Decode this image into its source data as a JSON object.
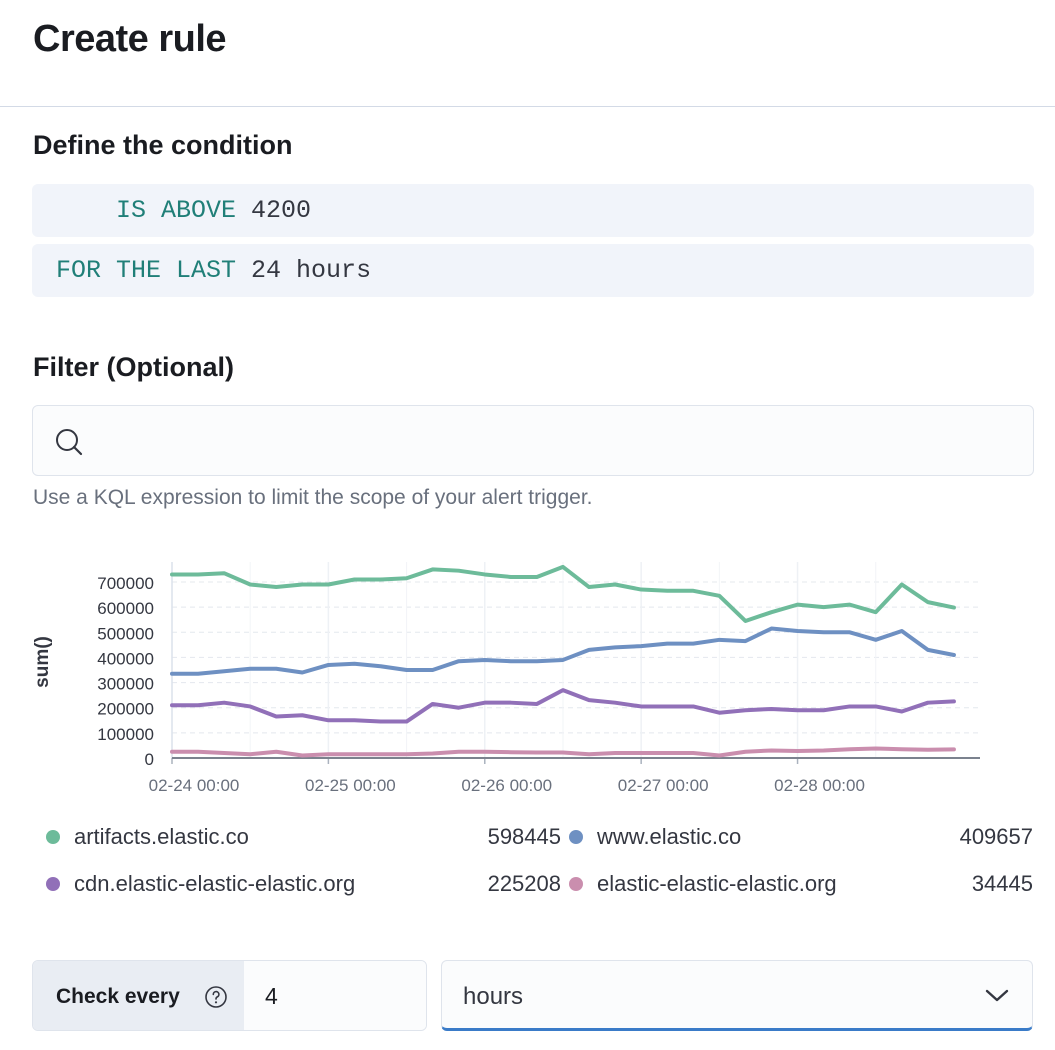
{
  "header": {
    "title": "Create rule"
  },
  "condition": {
    "section_title": "Define the condition",
    "threshold_keyword": "IS ABOVE",
    "threshold_value": "4200",
    "window_keyword": "FOR THE LAST",
    "window_value": "24 hours"
  },
  "filter": {
    "section_title": "Filter (Optional)",
    "query_value": "",
    "placeholder": "",
    "icon": "search-icon",
    "help_text": "Use a KQL expression to limit the scope of your alert trigger."
  },
  "chart_data": {
    "type": "line",
    "title": "",
    "xlabel": "",
    "ylabel": "sum()",
    "ylim": [
      0,
      700000
    ],
    "yticks": [
      "700000",
      "600000",
      "500000",
      "400000",
      "300000",
      "200000",
      "100000",
      "0"
    ],
    "xticks": [
      "02-24 00:00",
      "02-25 00:00",
      "02-26 00:00",
      "02-27 00:00",
      "02-28 00:00"
    ],
    "grid": true,
    "x_points": 32,
    "series": [
      {
        "name": "artifacts.elastic.co",
        "color": "#6dbb9a",
        "values": [
          730000,
          730000,
          735000,
          690000,
          680000,
          690000,
          690000,
          710000,
          710000,
          715000,
          750000,
          745000,
          730000,
          720000,
          720000,
          760000,
          680000,
          690000,
          670000,
          665000,
          665000,
          645000,
          545000,
          580000,
          610000,
          600000,
          610000,
          580000,
          690000,
          620000,
          598445
        ]
      },
      {
        "name": "www.elastic.co",
        "color": "#6e90c2",
        "values": [
          335000,
          335000,
          345000,
          355000,
          355000,
          340000,
          370000,
          375000,
          365000,
          350000,
          350000,
          385000,
          390000,
          385000,
          385000,
          390000,
          430000,
          440000,
          445000,
          455000,
          455000,
          470000,
          465000,
          515000,
          505000,
          500000,
          500000,
          470000,
          505000,
          430000,
          409657
        ]
      },
      {
        "name": "cdn.elastic-elastic-elastic.org",
        "color": "#9170b8",
        "values": [
          210000,
          210000,
          220000,
          205000,
          165000,
          170000,
          150000,
          150000,
          145000,
          145000,
          215000,
          200000,
          220000,
          220000,
          215000,
          270000,
          230000,
          220000,
          205000,
          205000,
          205000,
          180000,
          190000,
          195000,
          190000,
          190000,
          205000,
          205000,
          185000,
          220000,
          225208
        ]
      },
      {
        "name": "elastic-elastic-elastic.org",
        "color": "#ca8eae",
        "values": [
          25000,
          25000,
          20000,
          15000,
          25000,
          10000,
          15000,
          15000,
          15000,
          15000,
          18000,
          25000,
          25000,
          23000,
          22000,
          22000,
          15000,
          20000,
          20000,
          20000,
          20000,
          10000,
          25000,
          30000,
          28000,
          30000,
          35000,
          38000,
          35000,
          33000,
          34445
        ]
      }
    ]
  },
  "legend": [
    {
      "name": "artifacts.elastic.co",
      "value": "598445",
      "color": "#6dbb9a"
    },
    {
      "name": "www.elastic.co",
      "value": "409657",
      "color": "#6e90c2"
    },
    {
      "name": "cdn.elastic-elastic-elastic.org",
      "value": "225208",
      "color": "#9170b8"
    },
    {
      "name": "elastic-elastic-elastic.org",
      "value": "34445",
      "color": "#ca8eae"
    }
  ],
  "schedule": {
    "label": "Check every",
    "help_icon": "question-circle-icon",
    "interval_value": "4",
    "unit_value": "hours",
    "unit_icon": "chevron-down-icon"
  }
}
